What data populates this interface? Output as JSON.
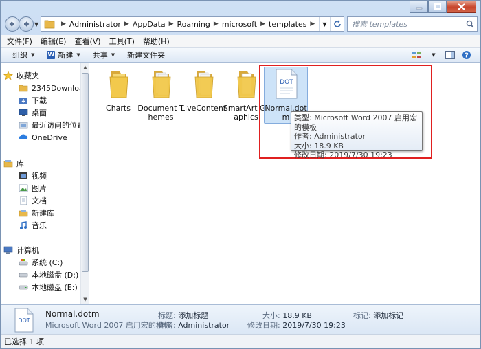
{
  "window": {
    "controls": {
      "minimize": "–",
      "maximize": "□",
      "close": "✕"
    }
  },
  "address": {
    "crumbs": [
      "Administrator",
      "AppData",
      "Roaming",
      "microsoft",
      "templates"
    ]
  },
  "search": {
    "placeholder": "搜索 templates"
  },
  "menu": [
    "文件(F)",
    "编辑(E)",
    "查看(V)",
    "工具(T)",
    "帮助(H)"
  ],
  "commands": {
    "organize": "组织",
    "new": "新建",
    "share": "共享",
    "new_folder": "新建文件夹"
  },
  "sidebar": {
    "favorites": "收藏夹",
    "fav_items": [
      "2345Downloads",
      "下载",
      "桌面",
      "最近访问的位置",
      "OneDrive"
    ],
    "libraries": "库",
    "lib_items": [
      "视频",
      "图片",
      "文档",
      "新建库",
      "音乐"
    ],
    "computer": "计算机",
    "drives": [
      "系统 (C:)",
      "本地磁盘 (D:)",
      "本地磁盘 (E:)"
    ]
  },
  "files": [
    {
      "name": "Charts",
      "type": "folder"
    },
    {
      "name": "Document Themes",
      "type": "folder"
    },
    {
      "name": "LiveContent",
      "type": "folder"
    },
    {
      "name": "SmartArt Graphics",
      "type": "folder"
    },
    {
      "name": "Normal.dotm",
      "type": "dot",
      "icon_text": "DOT",
      "selected": true
    }
  ],
  "tooltip": {
    "type_line": "类型: Microsoft Word 2007 启用宏的模板",
    "author_line": "作者: Administrator",
    "size_line": "大小: 18.9 KB",
    "modified_line": "修改日期: 2019/7/30 19:23"
  },
  "details": {
    "icon_text": "DOT",
    "name": "Normal.dotm",
    "type": "Microsoft Word 2007 启用宏的模板",
    "title_label": "标题:",
    "title_value": "添加标题",
    "author_label": "作者:",
    "author_value": "Administrator",
    "size_label": "大小:",
    "size_value": "18.9 KB",
    "modified_label": "修改日期:",
    "modified_value": "2019/7/30 19:23",
    "tags_label": "标记:",
    "tags_value": "添加标记"
  },
  "status": {
    "text": "已选择 1 项"
  },
  "colors": {
    "highlight_box": "#e02020",
    "selection": "#cde3f8",
    "folder": "#f2c94c",
    "word_blue": "#2b5fb3"
  }
}
